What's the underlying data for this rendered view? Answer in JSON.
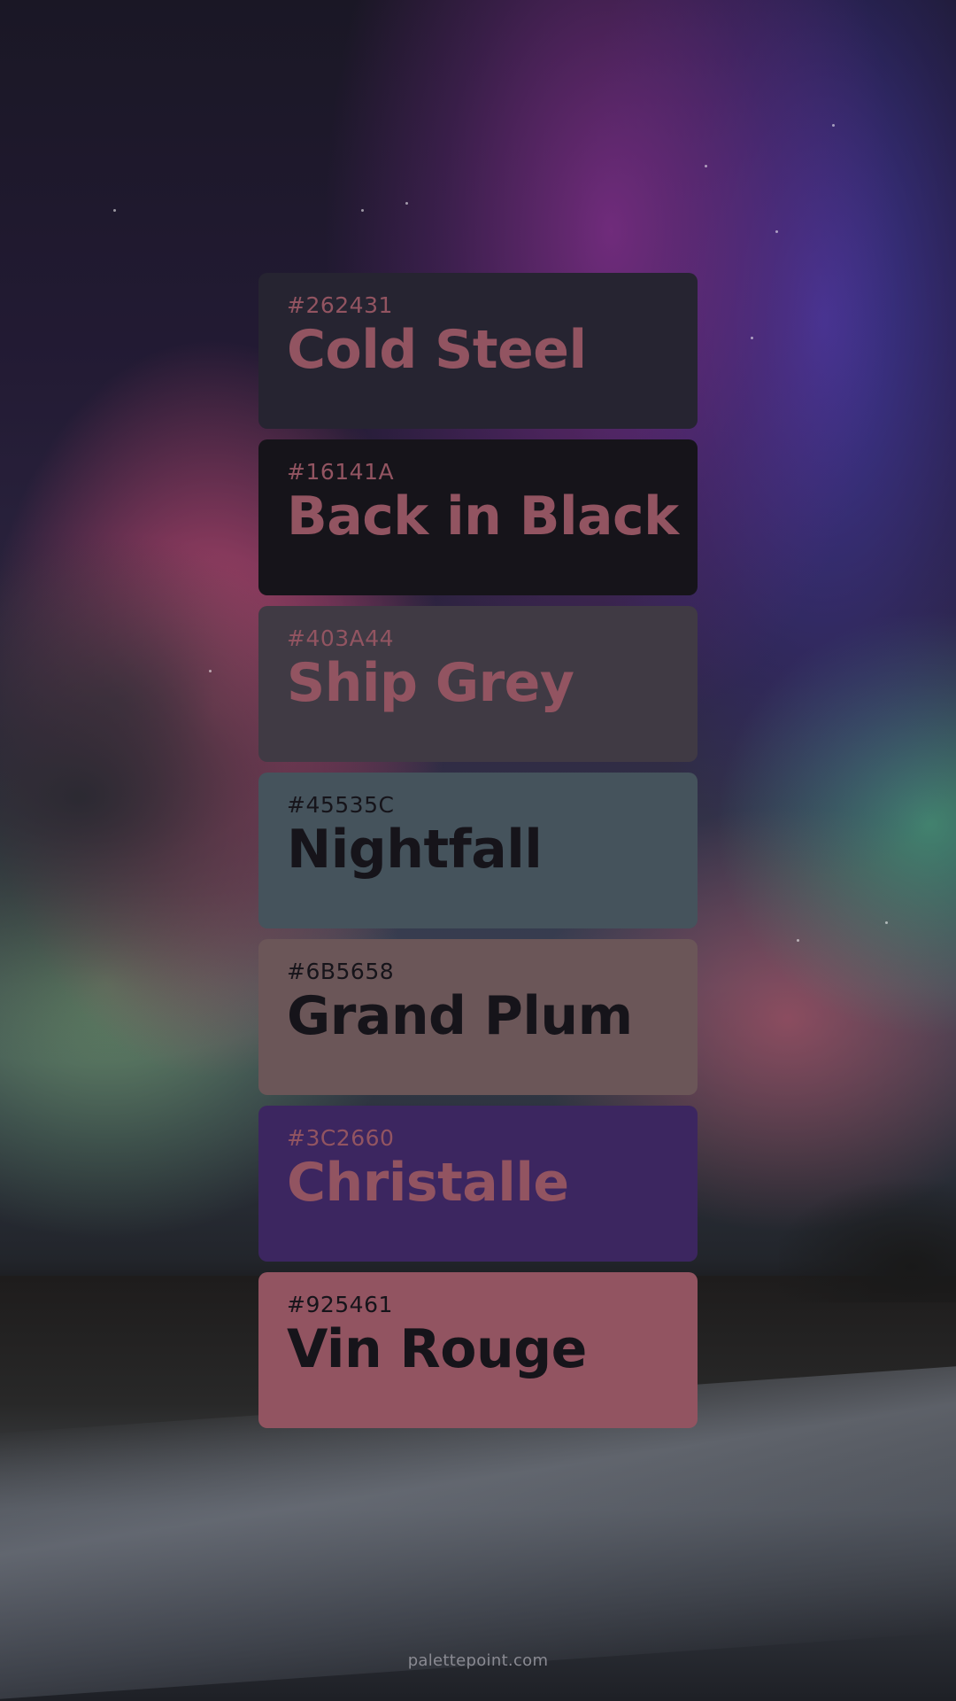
{
  "swatches": [
    {
      "hex": "#262431",
      "name": "Cold Steel",
      "bg": "#262431",
      "text_color": "#925461"
    },
    {
      "hex": "#16141A",
      "name": "Back in Black",
      "bg": "#16141A",
      "text_color": "#925461"
    },
    {
      "hex": "#403A44",
      "name": "Ship Grey",
      "bg": "#403A44",
      "text_color": "#925461"
    },
    {
      "hex": "#45535C",
      "name": "Nightfall",
      "bg": "#45535C",
      "text_color": "#16141A"
    },
    {
      "hex": "#6B5658",
      "name": "Grand Plum",
      "bg": "#6B5658",
      "text_color": "#16141A"
    },
    {
      "hex": "#3C2660",
      "name": "Christalle",
      "bg": "#3C2660",
      "text_color": "#925461"
    },
    {
      "hex": "#925461",
      "name": "Vin Rouge",
      "bg": "#925461",
      "text_color": "#16141A"
    }
  ],
  "footer": {
    "text": "palettepoint.com"
  },
  "background": {
    "scene": "aurora-night-sky-over-snowy-field"
  }
}
